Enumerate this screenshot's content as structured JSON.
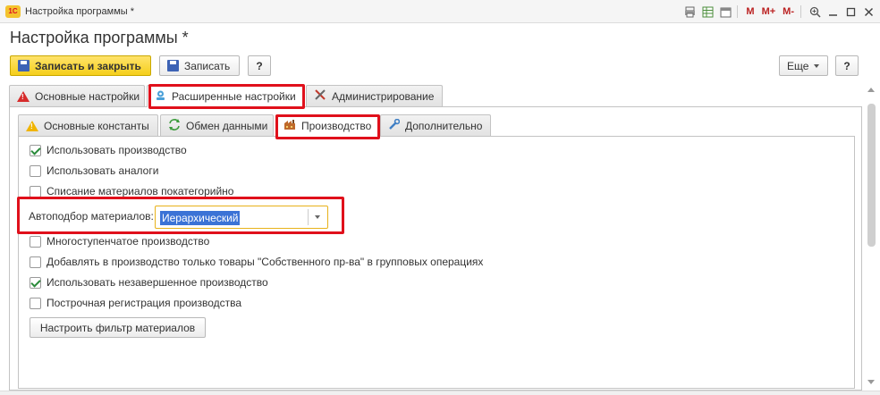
{
  "window": {
    "title": "Настройка программы *",
    "logo_text": "1С",
    "toolbar_icons": [
      "print-icon",
      "table-icon",
      "calendar-icon",
      "m-icon",
      "m-plus-icon",
      "m-minus-icon",
      "zoom-icon",
      "minimize-icon",
      "maximize-icon",
      "close-icon"
    ],
    "m_labels": {
      "m": "M",
      "mplus": "M+",
      "mminus": "M-"
    }
  },
  "page": {
    "title": "Настройка программы *"
  },
  "toolbar": {
    "save_close_label": "Записать и закрыть",
    "save_label": "Записать",
    "help_label": "?",
    "more_label": "Еще",
    "help2_label": "?"
  },
  "outer_tabs": [
    {
      "label": "Основные настройки",
      "icon": "warning-icon"
    },
    {
      "label": "Расширенные настройки",
      "icon": "settings-user-icon",
      "active": true
    },
    {
      "label": "Администрирование",
      "icon": "tools-icon"
    }
  ],
  "inner_tabs": [
    {
      "label": "Основные константы",
      "icon": "warning-icon"
    },
    {
      "label": "Обмен данными",
      "icon": "sync-icon"
    },
    {
      "label": "Производство",
      "icon": "factory-icon",
      "active": true
    },
    {
      "label": "Дополнительно",
      "icon": "wrench-icon"
    }
  ],
  "settings": {
    "use_production": {
      "label": "Использовать производство",
      "checked": true
    },
    "use_analogs": {
      "label": "Использовать аналоги",
      "checked": false
    },
    "write_off_by_category": {
      "label": "Списание материалов покатегорийно",
      "checked": false
    },
    "auto_selection": {
      "label": "Автоподбор материалов:",
      "value": "Иерархический"
    },
    "multi_stage": {
      "label": "Многоступенчатое производство",
      "checked": false
    },
    "add_own_goods": {
      "label": "Добавлять в производство только товары  \"Собственного пр-ва\" в групповых операциях",
      "checked": false
    },
    "use_wip": {
      "label": "Использовать незавершенное производство",
      "checked": true
    },
    "line_registration": {
      "label": "Построчная регистрация производства",
      "checked": false
    },
    "filter_button": "Настроить фильтр материалов"
  },
  "colors": {
    "highlight": "#e0101b",
    "primary_button": "#f5cf1b",
    "selection": "#3b73d6"
  }
}
